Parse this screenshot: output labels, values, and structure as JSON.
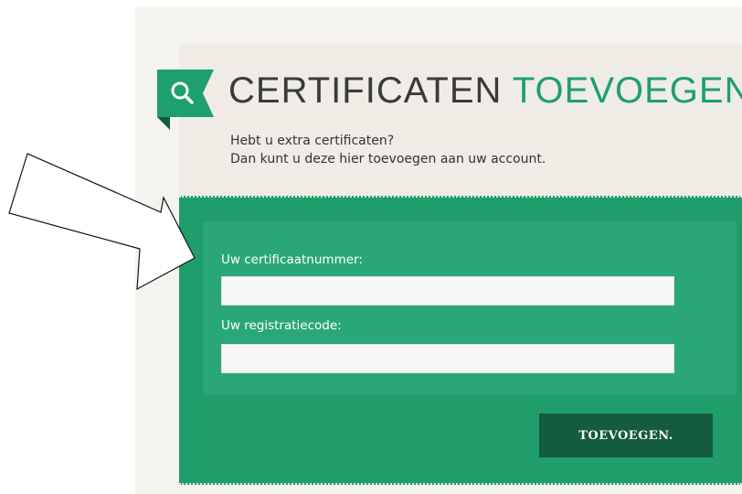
{
  "header": {
    "title_main": "CERTIFICATEN",
    "title_accent": "TOEVOEGEN.",
    "subtitle_line1": "Hebt u extra certificaten?",
    "subtitle_line2": "Dan kunt u deze hier toevoegen aan uw account."
  },
  "form": {
    "certificate_label": "Uw certificaatnummer:",
    "certificate_value": "",
    "registration_label": "Uw registratiecode:",
    "registration_value": "",
    "submit_label": "TOEVOEGEN."
  },
  "icons": {
    "title_icon": "search-icon",
    "annotation": "arrow-annotation-icon"
  },
  "colors": {
    "accent_green": "#1e9f6f",
    "panel_green": "#1f9e6c",
    "button_dark_green": "#145c3d",
    "title_gray": "#3a3a3a"
  }
}
